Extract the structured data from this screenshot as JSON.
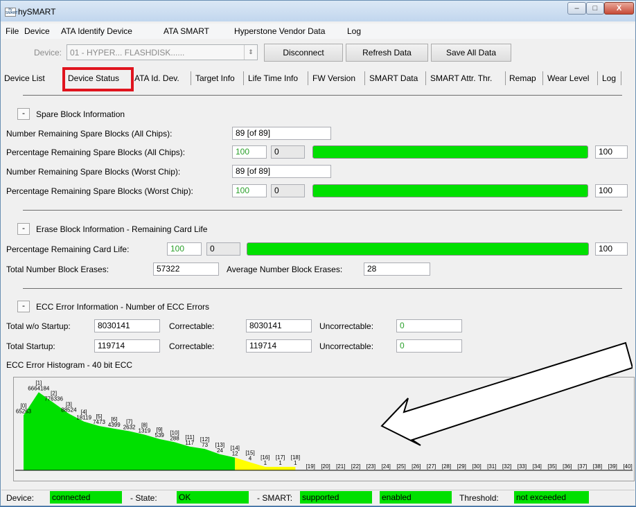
{
  "window": {
    "title": "hySMART",
    "app_icon_text": "hy SMART",
    "minimize_glyph": "–",
    "maximize_glyph": "□",
    "close_glyph": "X"
  },
  "menu": [
    "File",
    "Device",
    "ATA Identify Device",
    "ATA SMART",
    "Hyperstone Vendor Data",
    "Log"
  ],
  "toolbar": {
    "device_label": "Device:",
    "device_value": "01 - HYPER... FLASHDISK......",
    "disconnect": "Disconnect",
    "refresh": "Refresh Data",
    "save_all": "Save All Data"
  },
  "tabs": [
    "Device List",
    "Device Status",
    "ATA Id. Dev.",
    "Target Info",
    "Life Time Info",
    "FW Version",
    "SMART Data",
    "SMART Attr. Thr.",
    "Remap",
    "Wear Level",
    "Log"
  ],
  "spare": {
    "collapse": "-",
    "heading": "Spare Block Information",
    "num_all_label": "Number Remaining Spare Blocks (All Chips):",
    "num_all_value": "89 [of 89]",
    "pct_all_label": "Percentage Remaining Spare Blocks (All Chips):",
    "pct_all_value": "100",
    "pct_all_min": "0",
    "pct_all_max": "100",
    "pct_all_fill": 1.0,
    "num_worst_label": "Number Remaining Spare Blocks (Worst Chip):",
    "num_worst_value": "89 [of 89]",
    "pct_worst_label": "Percentage Remaining Spare Blocks (Worst Chip):",
    "pct_worst_value": "100",
    "pct_worst_min": "0",
    "pct_worst_max": "100",
    "pct_worst_fill": 1.0
  },
  "erase": {
    "collapse": "-",
    "heading": "Erase Block Information - Remaining Card Life",
    "pct_life_label": "Percentage Remaining Card Life:",
    "pct_life_value": "100",
    "pct_life_min": "0",
    "pct_life_max": "100",
    "pct_life_fill": 1.0,
    "total_erases_label": "Total Number Block Erases:",
    "total_erases_value": "57322",
    "avg_erases_label": "Average Number Block Erases:",
    "avg_erases_value": "28"
  },
  "ecc": {
    "collapse": "-",
    "heading": "ECC Error Information - Number of ECC Errors",
    "row1_label": "Total w/o Startup:",
    "row1_total": "8030141",
    "row1_corr_label": "Correctable:",
    "row1_corr": "8030141",
    "row1_uncorr_label": "Uncorrectable:",
    "row1_uncorr": "0",
    "row2_label": "Total Startup:",
    "row2_total": "119714",
    "row2_corr_label": "Correctable:",
    "row2_corr": "119714",
    "row2_uncorr_label": "Uncorrectable:",
    "row2_uncorr": "0",
    "histogram_label": "ECC Error Histogram - 40 bit ECC"
  },
  "chart_data": {
    "type": "area",
    "title": "ECC Error Histogram - 40 bit ECC",
    "categories": [
      "[0]",
      "[1]",
      "[2]",
      "[3]",
      "[4]",
      "[5]",
      "[6]",
      "[7]",
      "[8]",
      "[9]",
      "[10]",
      "[11]",
      "[12]",
      "[13]",
      "[14]",
      "[15]",
      "[16]",
      "[17]",
      "[18]",
      "[19]",
      "[20]",
      "[21]",
      "[22]",
      "[23]",
      "[24]",
      "[25]",
      "[26]",
      "[27]",
      "[28]",
      "[29]",
      "[30]",
      "[31]",
      "[32]",
      "[33]",
      "[34]",
      "[35]",
      "[36]",
      "[37]",
      "[38]",
      "[39]",
      "[40]"
    ],
    "values": [
      "65263",
      "6664184",
      "776336",
      "88524",
      "18119",
      "7473",
      "4399",
      "2632",
      "1319",
      "539",
      "288",
      "117",
      "73",
      "24",
      "12",
      "4",
      "1",
      "1",
      "1",
      "",
      "",
      "",
      "",
      "",
      "",
      "",
      "",
      "",
      "",
      "",
      "",
      "",
      "",
      "",
      "",
      "",
      "",
      "",
      "",
      "",
      ""
    ],
    "fill_colors": {
      "normal": "#00e000",
      "warning": "#ffff00"
    },
    "warning_from_index": 14,
    "log_scale": true
  },
  "status": {
    "device_label": "Device:",
    "device_value": "connected",
    "state_label": "- State:",
    "state_value": "OK",
    "smart_label": "- SMART:",
    "smart_value": "supported",
    "smart_enabled": "enabled",
    "threshold_label": "Threshold:",
    "threshold_value": "not exceeded",
    "ok_color": "#00e000"
  }
}
